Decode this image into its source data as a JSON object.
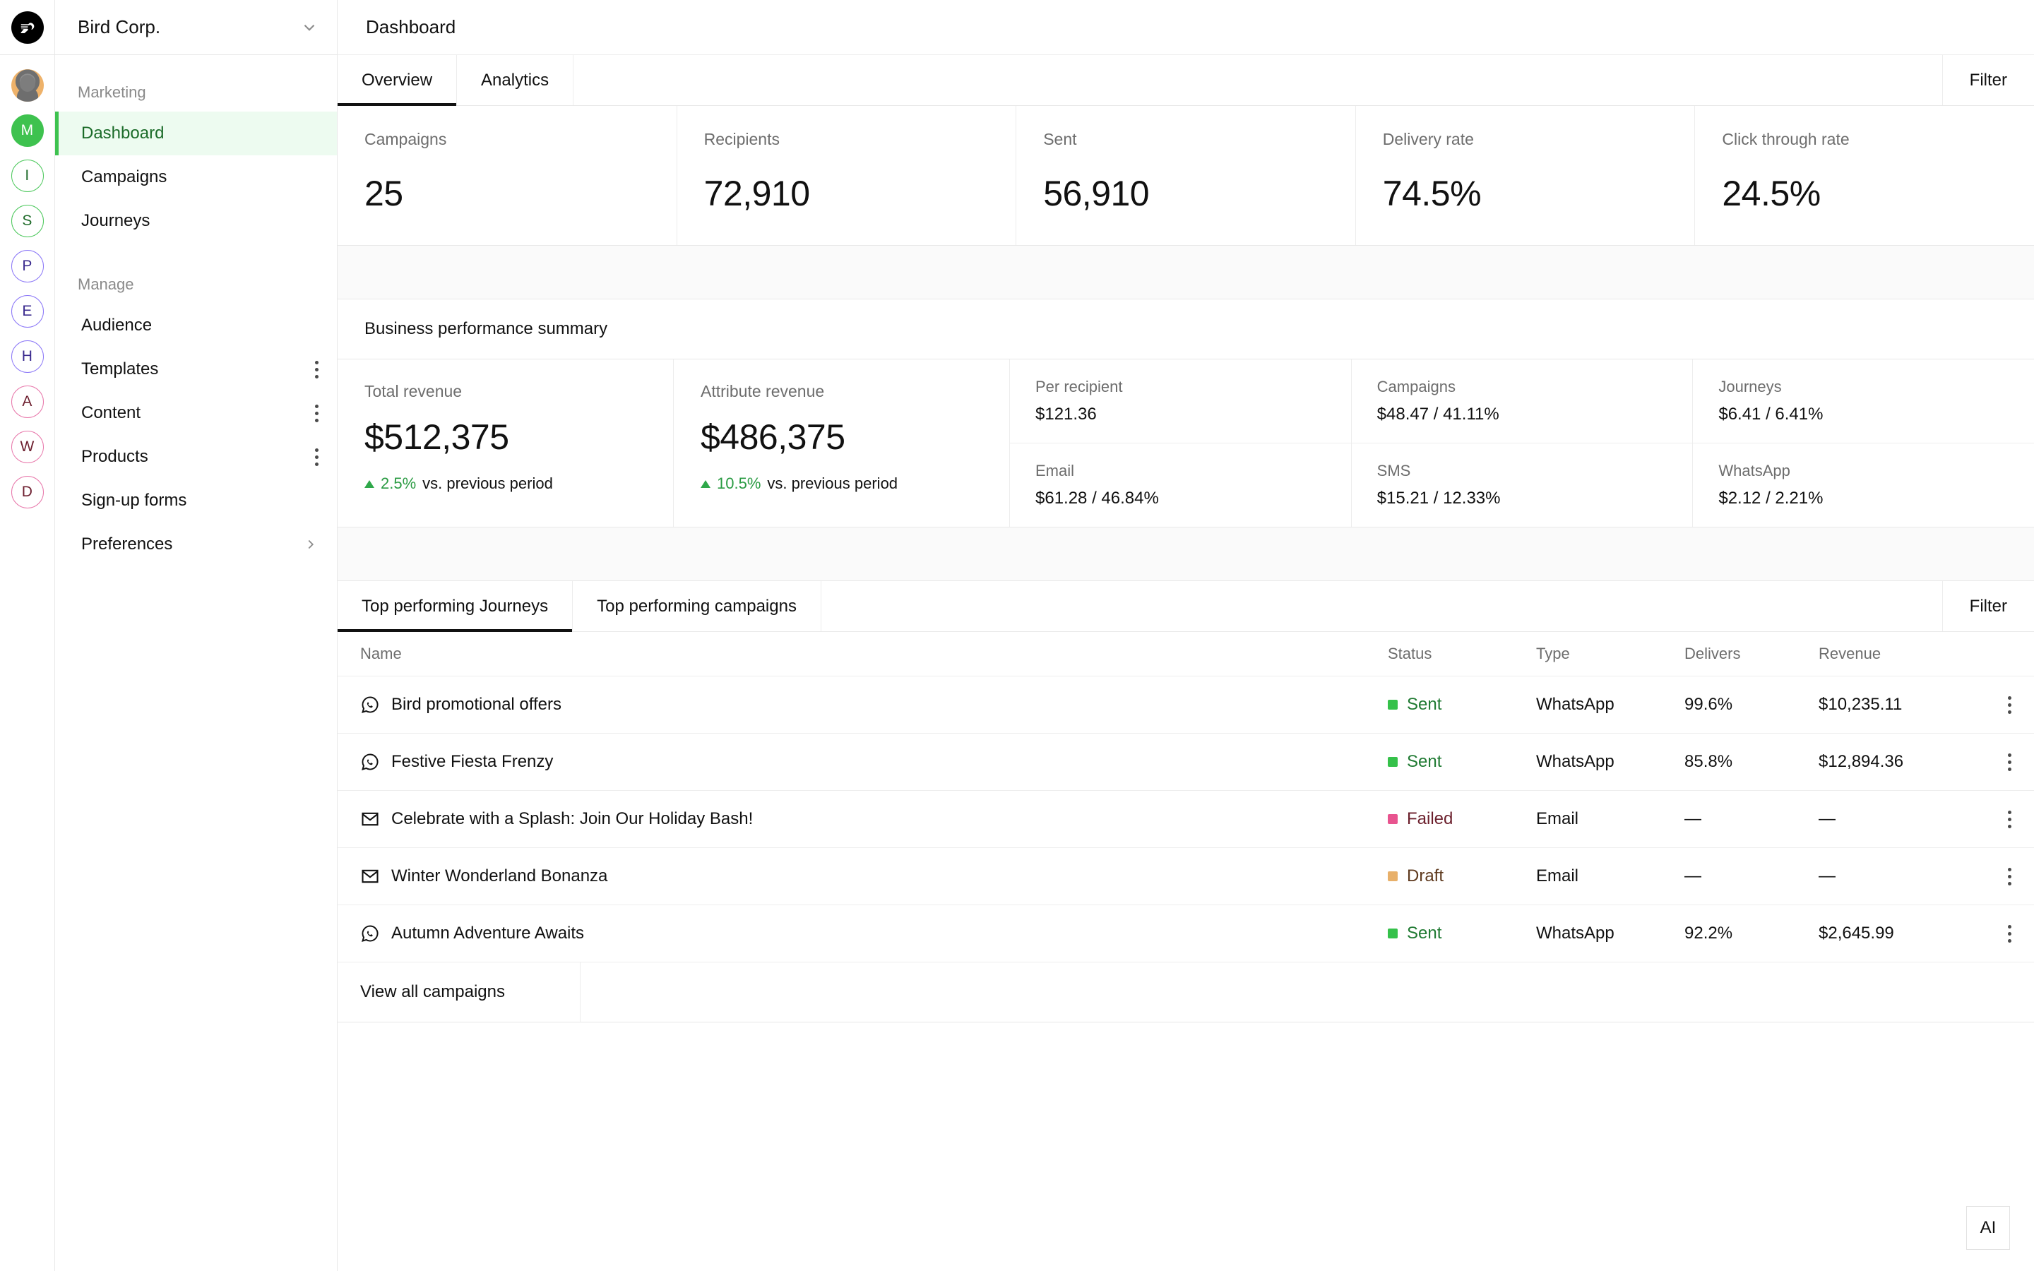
{
  "brand": {
    "logo_icon": "bird-logo-icon",
    "workspace": "Bird Corp.",
    "accent_green": "#3ec24f",
    "active_bg": "#edfbf0"
  },
  "rail": {
    "avatars": [
      {
        "label": "",
        "kind": "photo",
        "name": "user-avatar"
      },
      {
        "label": "M",
        "kind": "filled-green",
        "name": "workspace-avatar-m"
      },
      {
        "label": "I",
        "kind": "out-green",
        "name": "workspace-avatar-i"
      },
      {
        "label": "S",
        "kind": "out-green",
        "name": "workspace-avatar-s"
      },
      {
        "label": "P",
        "kind": "out-purple",
        "name": "workspace-avatar-p"
      },
      {
        "label": "E",
        "kind": "out-purple",
        "name": "workspace-avatar-e"
      },
      {
        "label": "H",
        "kind": "out-purple",
        "name": "workspace-avatar-h"
      },
      {
        "label": "A",
        "kind": "out-pink",
        "name": "workspace-avatar-a"
      },
      {
        "label": "W",
        "kind": "out-pink",
        "name": "workspace-avatar-w"
      },
      {
        "label": "D",
        "kind": "out-pink",
        "name": "workspace-avatar-d"
      }
    ]
  },
  "sidebar": {
    "sections": [
      {
        "label": "Marketing",
        "items": [
          {
            "label": "Dashboard",
            "active": true,
            "trailing": "none"
          },
          {
            "label": "Campaigns",
            "active": false,
            "trailing": "none"
          },
          {
            "label": "Journeys",
            "active": false,
            "trailing": "none"
          }
        ]
      },
      {
        "label": "Manage",
        "items": [
          {
            "label": "Audience",
            "active": false,
            "trailing": "none"
          },
          {
            "label": "Templates",
            "active": false,
            "trailing": "dots"
          },
          {
            "label": "Content",
            "active": false,
            "trailing": "dots"
          },
          {
            "label": "Products",
            "active": false,
            "trailing": "dots"
          },
          {
            "label": "Sign-up forms",
            "active": false,
            "trailing": "none"
          },
          {
            "label": "Preferences",
            "active": false,
            "trailing": "chevron"
          }
        ]
      }
    ]
  },
  "topbar": {
    "title": "Dashboard"
  },
  "main_tabs": {
    "tabs": [
      {
        "label": "Overview",
        "active": true
      },
      {
        "label": "Analytics",
        "active": false
      }
    ],
    "filter_label": "Filter"
  },
  "kpis": [
    {
      "label": "Campaigns",
      "value": "25"
    },
    {
      "label": "Recipients",
      "value": "72,910"
    },
    {
      "label": "Sent",
      "value": "56,910"
    },
    {
      "label": "Delivery rate",
      "value": "74.5%"
    },
    {
      "label": "Click through rate",
      "value": "24.5%"
    }
  ],
  "performance": {
    "title": "Business performance summary",
    "primary": [
      {
        "label": "Total revenue",
        "value": "$512,375",
        "delta_pct": "2.5%",
        "delta_suffix": "vs. previous period",
        "direction": "up"
      },
      {
        "label": "Attribute revenue",
        "value": "$486,375",
        "delta_pct": "10.5%",
        "delta_suffix": "vs. previous period",
        "direction": "up"
      }
    ],
    "breakdown_top": [
      {
        "label": "Per recipient",
        "value": "$121.36"
      },
      {
        "label": "Campaigns",
        "value": "$48.47 / 41.11%"
      },
      {
        "label": "Journeys",
        "value": "$6.41 / 6.41%"
      }
    ],
    "breakdown_bottom": [
      {
        "label": "Email",
        "value": "$61.28 / 46.84%"
      },
      {
        "label": "SMS",
        "value": "$15.21 / 12.33%"
      },
      {
        "label": "WhatsApp",
        "value": "$2.12 / 2.21%"
      }
    ]
  },
  "table_section": {
    "tabs": [
      {
        "label": "Top performing Journeys",
        "active": true
      },
      {
        "label": "Top performing campaigns",
        "active": false
      }
    ],
    "filter_label": "Filter",
    "columns": [
      "Name",
      "Status",
      "Type",
      "Delivers",
      "Revenue"
    ],
    "rows": [
      {
        "icon": "whatsapp-icon",
        "name": "Bird promotional offers",
        "status": "Sent",
        "status_kind": "sent",
        "type": "WhatsApp",
        "delivers": "99.6%",
        "revenue": "$10,235.11"
      },
      {
        "icon": "whatsapp-icon",
        "name": "Festive Fiesta Frenzy",
        "status": "Sent",
        "status_kind": "sent",
        "type": "WhatsApp",
        "delivers": "85.8%",
        "revenue": "$12,894.36"
      },
      {
        "icon": "email-icon",
        "name": "Celebrate with a Splash: Join Our Holiday Bash!",
        "status": "Failed",
        "status_kind": "failed",
        "type": "Email",
        "delivers": "—",
        "revenue": "—"
      },
      {
        "icon": "email-icon",
        "name": "Winter Wonderland Bonanza",
        "status": "Draft",
        "status_kind": "draft",
        "type": "Email",
        "delivers": "—",
        "revenue": "—"
      },
      {
        "icon": "whatsapp-icon",
        "name": "Autumn Adventure Awaits",
        "status": "Sent",
        "status_kind": "sent",
        "type": "WhatsApp",
        "delivers": "92.2%",
        "revenue": "$2,645.99"
      }
    ],
    "view_all_label": "View all campaigns",
    "status_colors": {
      "sent_square": "#35c14a",
      "sent_text": "#1f7a32",
      "failed_square": "#e8548f",
      "failed_text": "#6b1f2c",
      "draft_square": "#e8b06a",
      "draft_text": "#5e3a1e"
    }
  },
  "ai_button": {
    "label": "AI"
  }
}
